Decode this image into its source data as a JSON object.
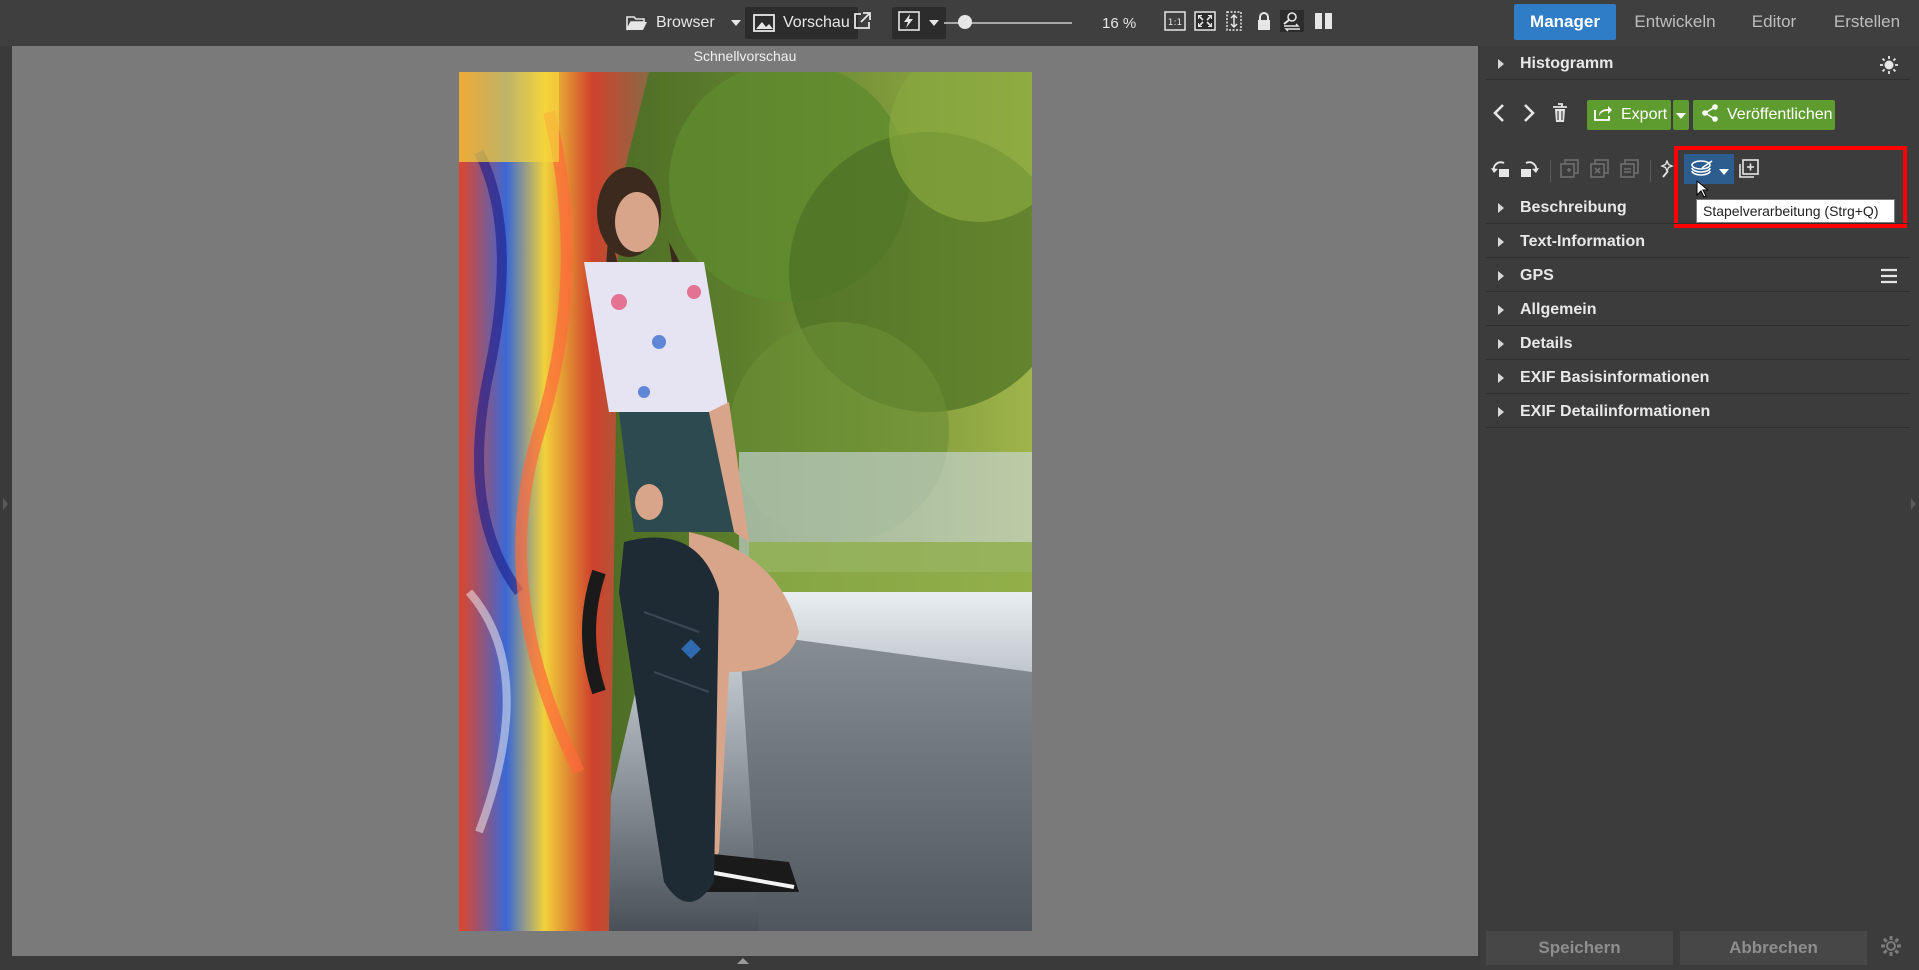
{
  "toolbar": {
    "browser_label": "Browser",
    "preview_label": "Vorschau",
    "zoom_value": "16 %",
    "zoom_level_fraction": 0.16
  },
  "modules": {
    "manager": "Manager",
    "develop": "Entwickeln",
    "editor": "Editor",
    "create": "Erstellen",
    "active": "Manager"
  },
  "viewer": {
    "title": "Schnellvorschau"
  },
  "panel": {
    "histogram_label": "Histogramm",
    "export_label": "Export",
    "publish_label": "Veröffentlichen",
    "tooltip": "Stapelverarbeitung (Strg+Q)",
    "sections": [
      "Beschreibung",
      "Text-Information",
      "GPS",
      "Allgemein",
      "Details",
      "EXIF Basisinformationen",
      "EXIF Detailinformationen"
    ],
    "save_label": "Speichern",
    "cancel_label": "Abbrechen"
  },
  "colors": {
    "accent_active_tab": "#2f7cc7",
    "action_green": "#5e9c2f",
    "highlight_red": "#ff0000"
  }
}
